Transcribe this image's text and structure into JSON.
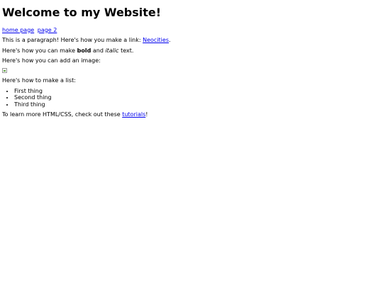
{
  "heading": "Welcome to my Website!",
  "nav": {
    "home_label": "home page",
    "page2_label": "page 2"
  },
  "para_link": {
    "before": "This is a paragraph! Here's how you make a link: ",
    "link_label": "Neocities",
    "after": "."
  },
  "para_format": {
    "before": "Here's how you can make ",
    "bold": "bold",
    "middle": " and ",
    "italic": "italic",
    "after": " text."
  },
  "para_image": "Here's how you can add an image:",
  "image_icon": "broken-image-icon",
  "para_list": "Here's how to make a list:",
  "list_items": [
    "First thing",
    "Second thing",
    "Third thing"
  ],
  "para_learn": {
    "before": "To learn more HTML/CSS, check out these ",
    "link_label": "tutorials",
    "after": "!"
  },
  "colors": {
    "link": "#0000ee",
    "text": "#000000",
    "background": "#ffffff"
  }
}
